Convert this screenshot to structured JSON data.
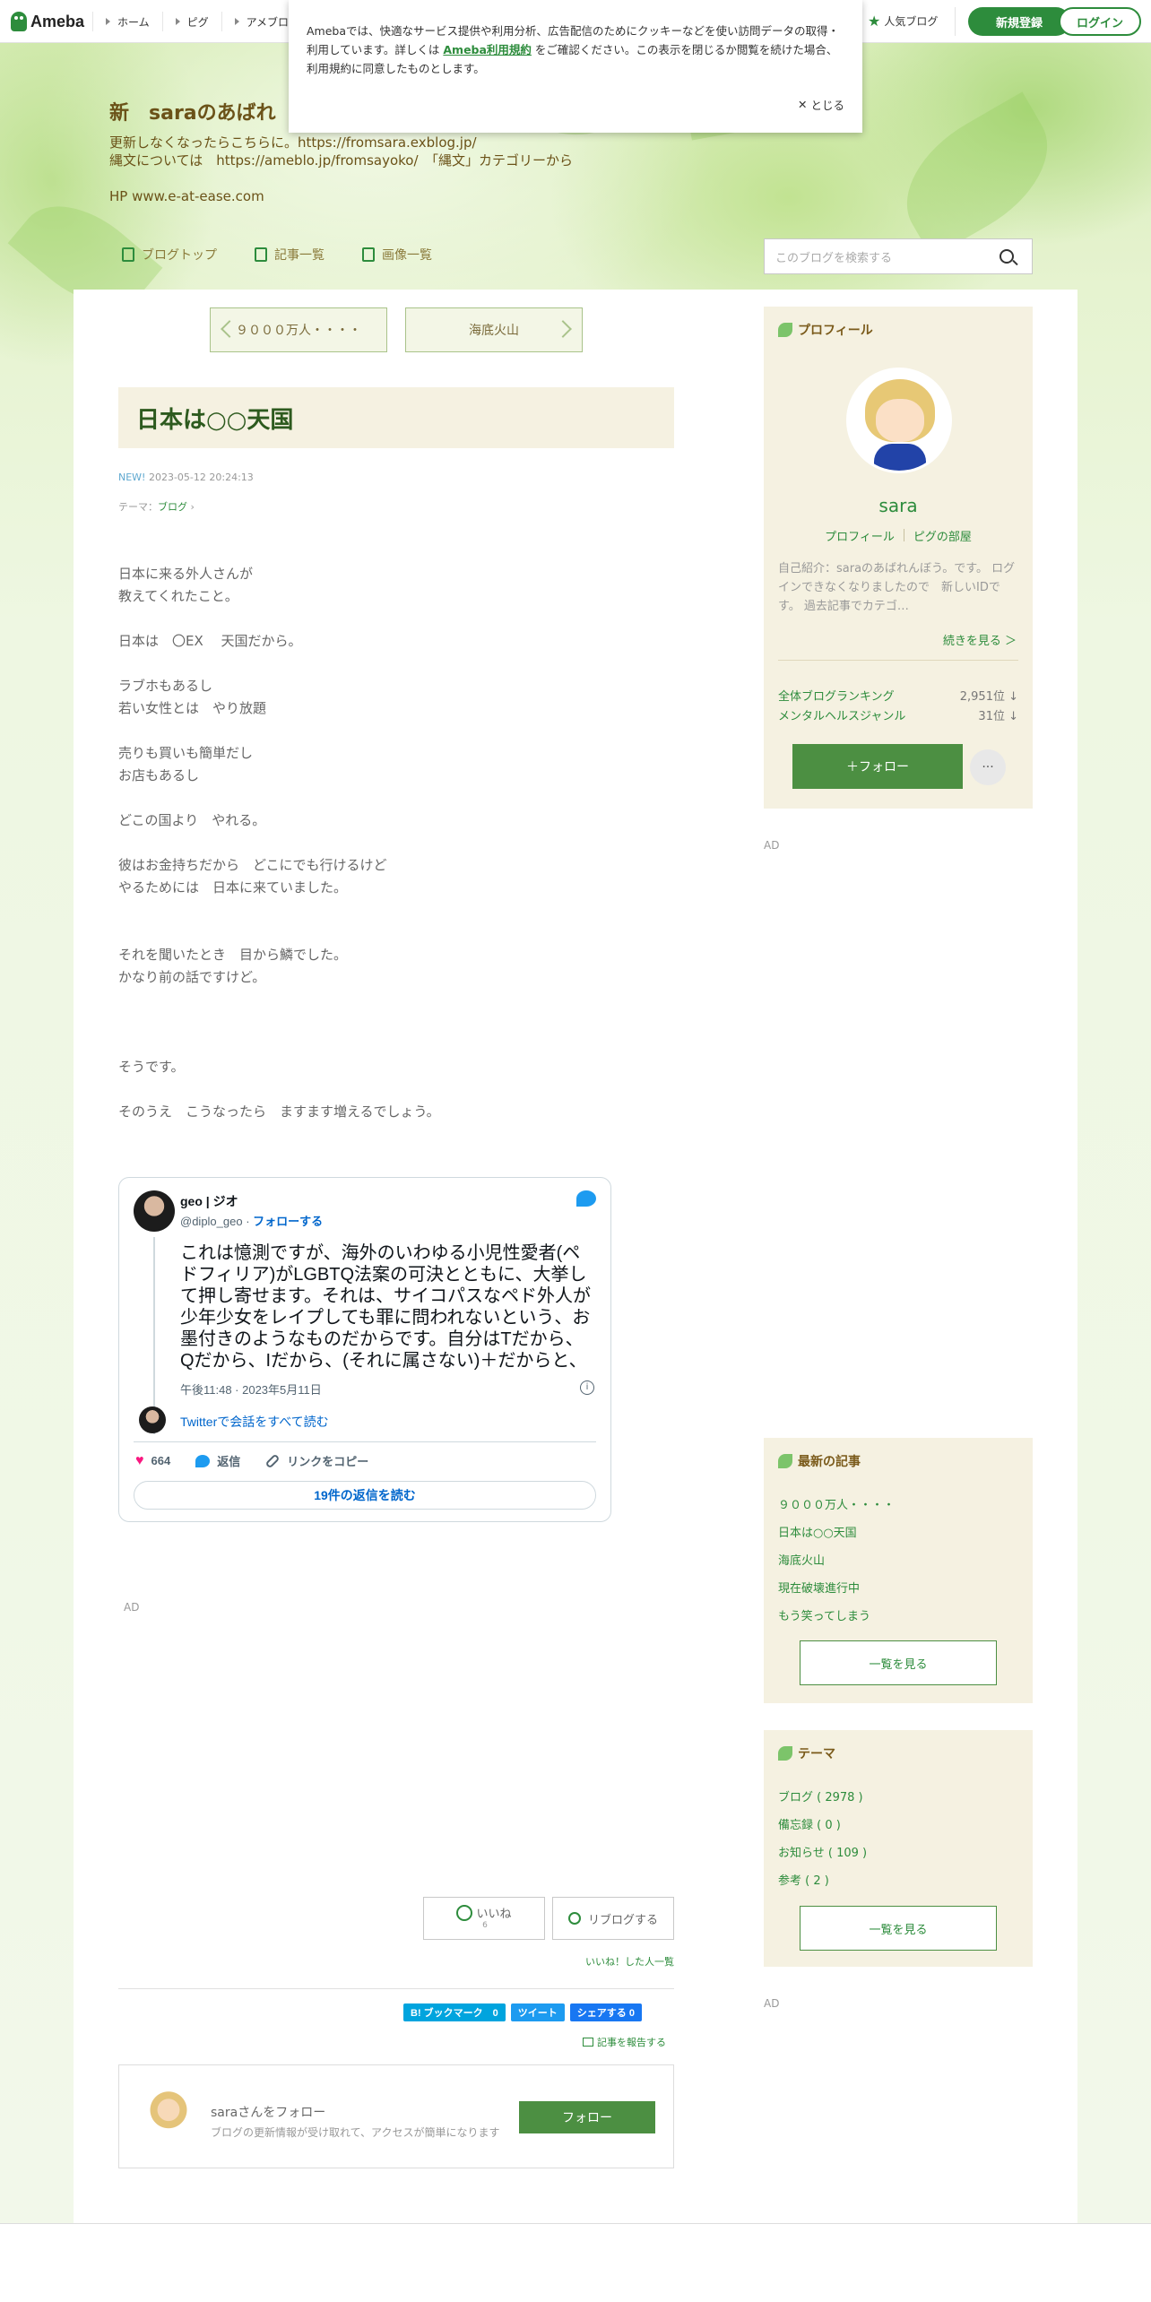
{
  "topbar": {
    "logo": "Ameba",
    "nav": [
      "ホーム",
      "ピグ",
      "アメブロ"
    ],
    "popular": "人気ブログ",
    "signup": "新規登録",
    "login": "ログイン"
  },
  "cookie": {
    "text_before": "Amebaでは、快適なサービス提供や利用分析、広告配信のためにクッキーなどを使い訪問データの取得・利用しています。詳しくは",
    "link": "Ameba利用規約",
    "text_after": "をご確認ください。この表示を閉じるか閲覧を続けた場合、利用規約に同意したものとします。",
    "close": "とじる"
  },
  "blog": {
    "title": "新　saraのあばれ",
    "desc": [
      "更新しなくなったらこちらに。https://fromsara.exblog.jp/",
      "縄文については　https://ameblo.jp/fromsayoko/　「縄文」カテゴリーから",
      "",
      "HP www.e-at-ease.com"
    ],
    "nav": [
      "ブログトップ",
      "記事一覧",
      "画像一覧"
    ],
    "search_placeholder": "このブログを検索する"
  },
  "pager": {
    "prev": "９０００万人・・・・",
    "next": "海底火山"
  },
  "article": {
    "title": "日本は○○天国",
    "new": "NEW!",
    "datetime": "2023-05-12 20:24:13",
    "theme_label": "テーマ：",
    "theme": "ブログ",
    "body": [
      "日本に来る外人さんが",
      "教えてくれたこと。",
      "",
      "日本は　〇EX　 天国だから。",
      "",
      "ラブホもあるし",
      "若い女性とは　やり放題",
      "",
      "売りも買いも簡単だし",
      "お店もあるし",
      "",
      "どこの国より　やれる。",
      "",
      "彼はお金持ちだから　どこにでも行けるけど",
      "やるためには　日本に来ていました。",
      "",
      "",
      "それを聞いたとき　目から鱗でした。",
      "かなり前の話ですけど。",
      "",
      "",
      "",
      "そうです。",
      "",
      "そのうえ　こうなったら　ますます増えるでしょう。"
    ]
  },
  "tweet": {
    "name": "geo | ジオ",
    "handle": "@diplo_geo · ",
    "follow": "フォローする",
    "text": "これは憶測ですが、海外のいわゆる小児性愛者(ペドフィリア)がLGBTQ法案の可決とともに、大挙して押し寄せます。それは、サイコパスなペド外人が少年少女をレイプしても罪に問われないという、お墨付きのようなものだからです。自分はTだから、Qだから、Iだから、(それに属さない)＋だからと、",
    "date": "午後11:48 · 2023年5月11日",
    "conversation": "Twitterで会話をすべて読む",
    "likes": "664",
    "reply": "返信",
    "copy_link": "リンクをコピー",
    "read_replies": "19件の返信を読む"
  },
  "ad_label": "AD",
  "actions": {
    "like": "いいね",
    "like_count": "6",
    "reblog": "リブログする",
    "likes_list": "いいね！した人一覧",
    "bookmark": "B! ブックマーク　0",
    "tweet": "ツイート",
    "share": "シェアする 0",
    "report": "記事を報告する"
  },
  "follow_box": {
    "name": "saraさんをフォロー",
    "sub": "ブログの更新情報が受け取れて、アクセスが簡単になります",
    "button": "フォロー"
  },
  "profile": {
    "heading": "プロフィール",
    "name": "sara",
    "link1": "プロフィール",
    "link2": "ピグの部屋",
    "intro": "自己紹介：saraのあばれんぼう。です。 ログインできなくなりましたので　新しいIDです。 過去記事でカテゴ…",
    "more": "続きを見る ＞",
    "rank1_label": "全体ブログランキング",
    "rank1_value": "2,951位 ↓",
    "rank2_label": "メンタルヘルスジャンル",
    "rank2_value": "31位 ↓",
    "follow": "フォロー",
    "dots": "···"
  },
  "recent": {
    "heading": "最新の記事",
    "items": [
      "９０００万人・・・・",
      "日本は○○天国",
      "海底火山",
      "現在破壊進行中",
      "もう笑ってしまう"
    ],
    "more": "一覧を見る"
  },
  "themes": {
    "heading": "テーマ",
    "items": [
      "ブログ ( 2978 )",
      "備忘録 ( 0 )",
      "お知らせ ( 109 )",
      "参考 ( 2 )"
    ],
    "more": "一覧を見る"
  }
}
